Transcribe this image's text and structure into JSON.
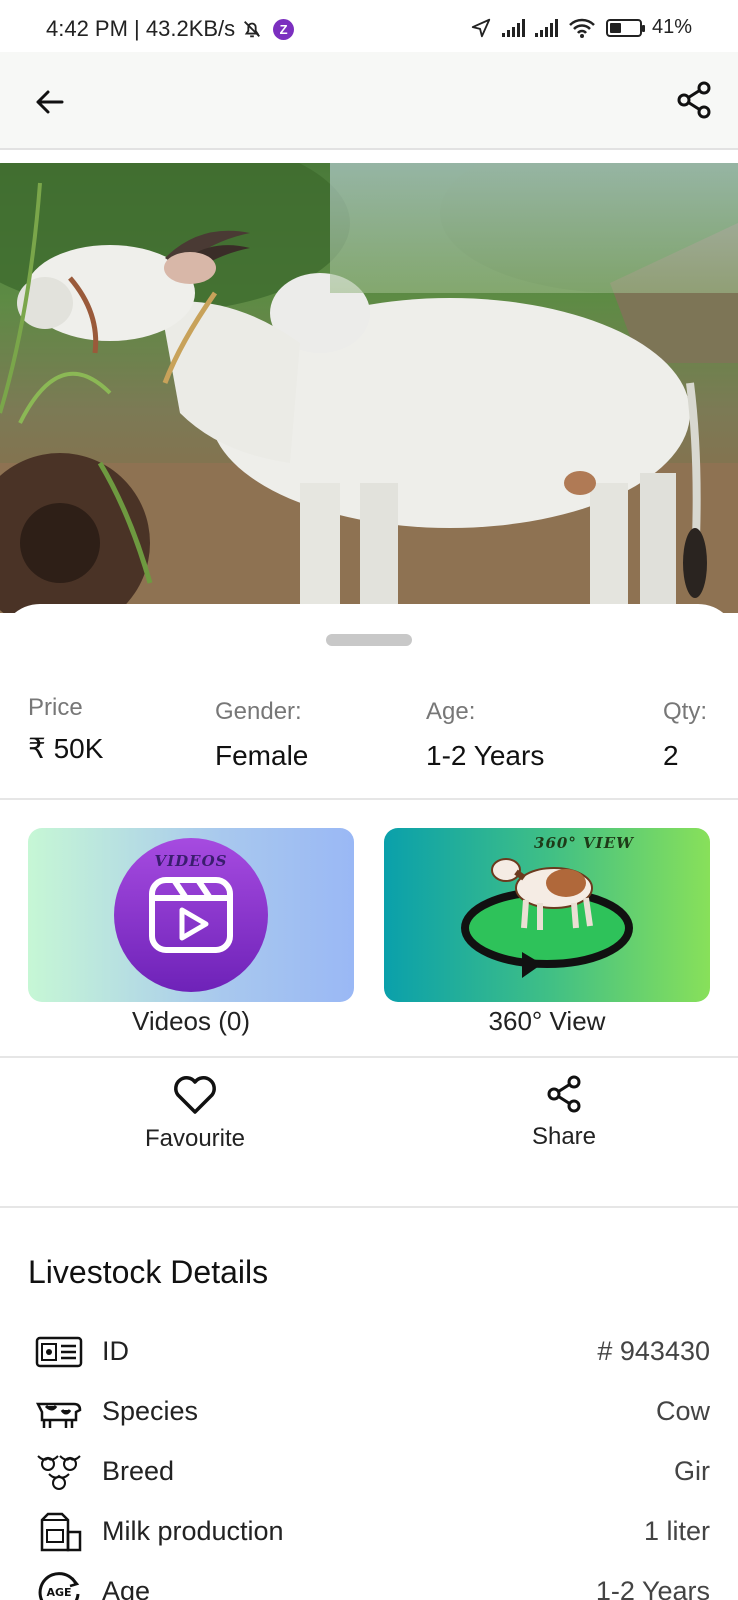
{
  "status_bar": {
    "time_speed": "4:42 PM | 43.2KB/s",
    "z_badge": "Z",
    "battery": "41%",
    "battery_level": 0.41
  },
  "toolbar": {
    "back_icon": "back-arrow-icon",
    "share_icon": "share-icon"
  },
  "hero": {
    "image": "white-cow-photo"
  },
  "summary": {
    "price_label": "Price",
    "price_value": "₹ 50K",
    "gender_label": "Gender:",
    "gender_value": "Female",
    "age_label": "Age:",
    "age_value": "1-2 Years",
    "qty_label": "Qty:",
    "qty_value": "2"
  },
  "media": {
    "videos_card_text": "VIDEOS",
    "videos_label": "Videos (0)",
    "view360_card_text": "360° VIEW",
    "view360_label": "360° View"
  },
  "actions": {
    "favourite_label": "Favourite",
    "share_label": "Share"
  },
  "details": {
    "title": "Livestock Details",
    "rows": [
      {
        "icon": "id-card-icon",
        "key": "ID",
        "value": "# 943430"
      },
      {
        "icon": "cow-icon",
        "key": "Species",
        "value": "Cow"
      },
      {
        "icon": "cattle-heads-icon",
        "key": "Breed",
        "value": "Gir"
      },
      {
        "icon": "milk-carton-icon",
        "key": "Milk production",
        "value": "1 liter"
      },
      {
        "icon": "age-icon",
        "key": "Age",
        "value": "1-2 Years"
      }
    ]
  },
  "colors": {
    "videos_circle": "#8e3bd6",
    "view360_start": "#0fa0a8",
    "view360_end": "#86e05a"
  }
}
